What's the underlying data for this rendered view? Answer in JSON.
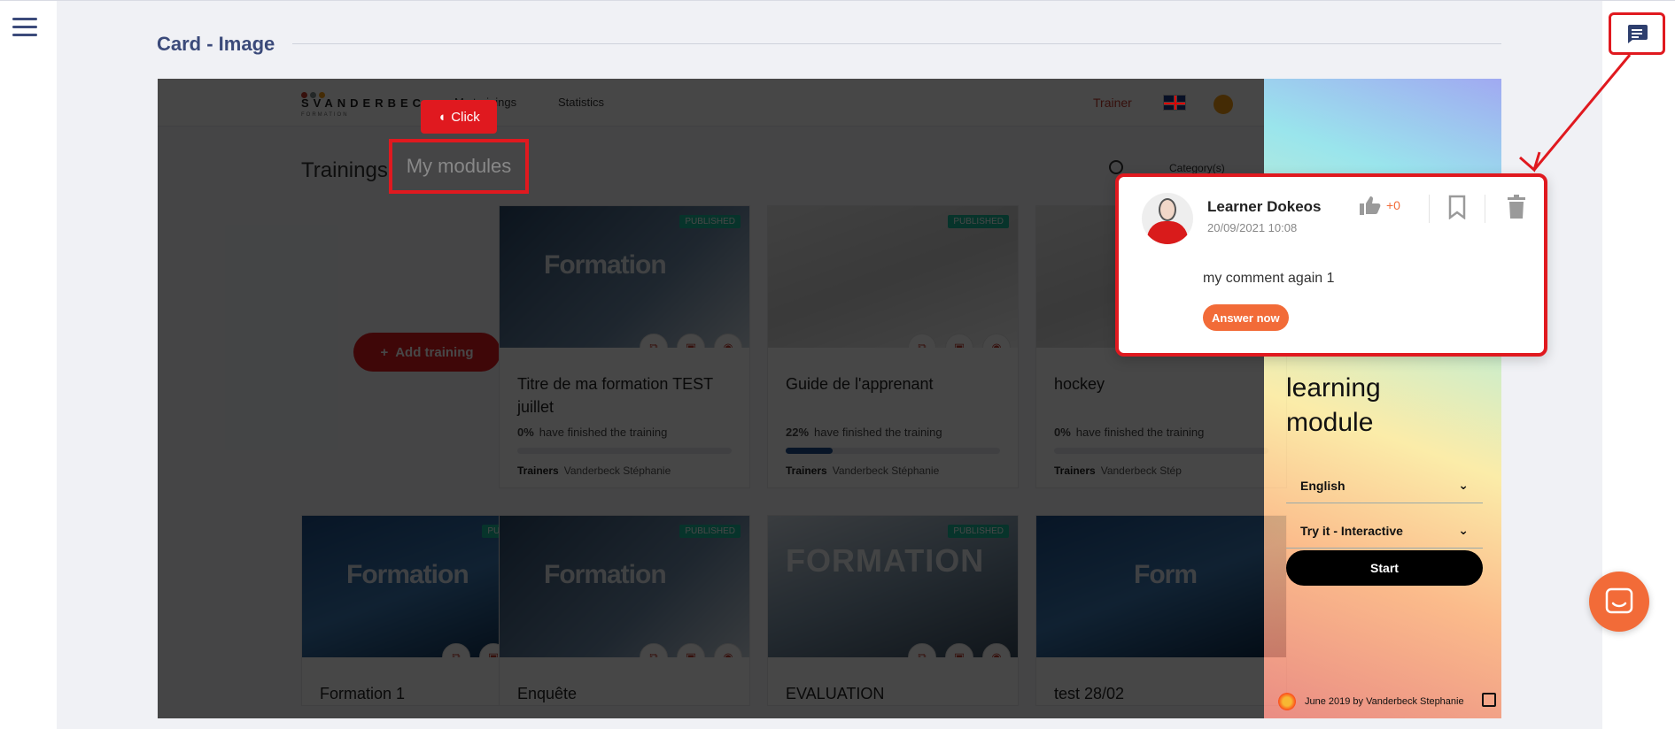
{
  "page": {
    "title": "Card - Image"
  },
  "app": {
    "brand": "SVANDERBEC",
    "brand_sub": "FORMATION",
    "nav_links": [
      "My trainings",
      "Statistics"
    ],
    "role": "Trainer",
    "tabs": {
      "trainings": "Trainings",
      "modules": "My modules"
    },
    "click_badge": "Click",
    "categories": "Category(s)",
    "add_training": "Add training",
    "status_published": "PUBLISHED",
    "trainers_label": "Trainers",
    "finished_text": "have finished the training",
    "cards_row1": [
      {
        "title": "Titre de ma formation TEST juillet",
        "image_text": "Formation",
        "percent": "0%",
        "progress": 0,
        "trainer": "Vanderbeck Stéphanie",
        "published": true
      },
      {
        "title": "Guide de l'apprenant",
        "image_text": "",
        "percent": "22%",
        "progress": 0.22,
        "trainer": "Vanderbeck Stéphanie",
        "published": true
      },
      {
        "title": "hockey",
        "image_text": "",
        "percent": "0%",
        "progress": 0,
        "trainer": "Vanderbeck Stép",
        "published": false
      }
    ],
    "cards_row2": [
      {
        "title": "Formation 1",
        "image_text": "Formation",
        "published": true
      },
      {
        "title": "Enquête",
        "image_text": "Formation",
        "published": true
      },
      {
        "title": "EVALUATION",
        "image_text": "FORMATION",
        "published": true
      },
      {
        "title": "test 28/02",
        "image_text": "Form",
        "published": false
      }
    ]
  },
  "side": {
    "title_lines": [
      "learning",
      "module"
    ],
    "language": "English",
    "mode": "Try it - Interactive",
    "start": "Start",
    "footer": "June 2019 by Vanderbeck Stephanie"
  },
  "comment": {
    "author": "Learner Dokeos",
    "date": "20/09/2021 10:08",
    "likes": "+0",
    "text": "my comment again 1",
    "answer_button": "Answer now"
  },
  "colors": {
    "accent_red": "#e0191f",
    "orange": "#f26b38",
    "navy": "#3b4a7a"
  }
}
